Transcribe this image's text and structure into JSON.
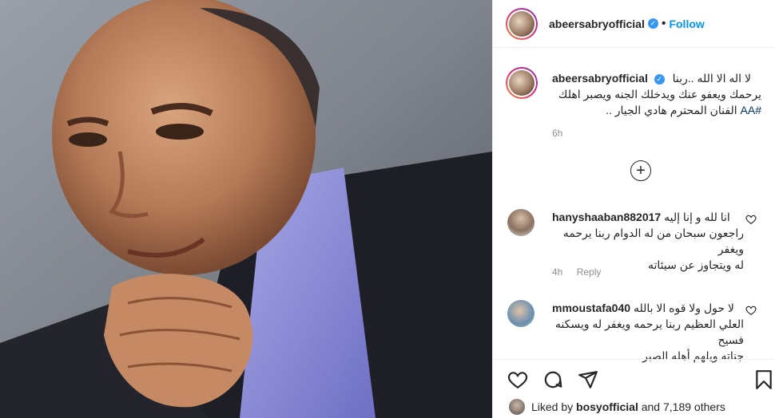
{
  "post": {
    "username": "abeersabryofficial",
    "follow_label": "Follow",
    "dot": "•",
    "verified_mark": "✓"
  },
  "caption": {
    "username": "abeersabryofficial",
    "line1": "لا اله الا الله ..ربنا",
    "line2": "يرحمك ويعفو عنك ويدخلك الجنه ويصبر اهلك",
    "line3": "الفنان المحترم هادي الجيار ..",
    "hashtag": "#AA",
    "time": "6h"
  },
  "load_more_icon": "plus-circle-icon",
  "comments": [
    {
      "username": "hanyshaaban882017",
      "line1": "انا لله و إنا إليه",
      "line2": "راجعون سبحان من له الدوام ربنا يرحمه ويغفر",
      "line3": "له ويتجاوز عن سيئاته",
      "time": "4h",
      "reply_label": "Reply"
    },
    {
      "username": "mmoustafa040",
      "line1": "لا حول ولا قوه الا بالله",
      "line2": "العلي العظيم ربنا يرحمه ويغفر له ويسكنه فسيح",
      "line3": "جناته ويلهم أهله الصبر"
    }
  ],
  "actions": {
    "icons": [
      "heart-icon",
      "comment-icon",
      "share-icon",
      "bookmark-icon"
    ]
  },
  "likes": {
    "prefix": "Liked by",
    "user": "bosyofficial",
    "suffix": "and 7,189 others"
  },
  "colors": {
    "link": "#0095f6",
    "verified": "#3897f0",
    "muted": "#8e8e8e"
  }
}
